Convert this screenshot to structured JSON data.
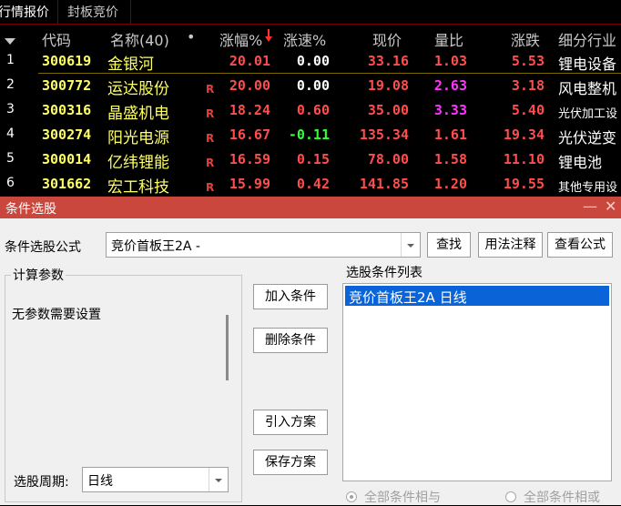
{
  "tabs": [
    "行情报价",
    "封板竞价"
  ],
  "columns": {
    "code": "代码",
    "name": "名称(40)",
    "dot": "•",
    "change_pct": "涨幅%",
    "speed": "涨速%",
    "price": "现价",
    "volume_ratio": "量比",
    "change": "涨跌",
    "industry": "细分行业"
  },
  "rows": [
    {
      "idx": "1",
      "code": "300619",
      "name": "金银河",
      "flag": "",
      "change_pct": "20.01",
      "speed": "0.00",
      "price": "33.16",
      "volume_ratio": "1.03",
      "change": "5.53",
      "industry": "锂电设备"
    },
    {
      "idx": "2",
      "code": "300772",
      "name": "运达股份",
      "flag": "R",
      "change_pct": "20.00",
      "speed": "0.00",
      "price": "19.08",
      "volume_ratio": "2.63",
      "change": "3.18",
      "industry": "风电整机"
    },
    {
      "idx": "3",
      "code": "300316",
      "name": "晶盛机电",
      "flag": "R",
      "change_pct": "18.24",
      "speed": "0.60",
      "price": "35.00",
      "volume_ratio": "3.33",
      "change": "5.40",
      "industry": "光伏加工设"
    },
    {
      "idx": "4",
      "code": "300274",
      "name": "阳光电源",
      "flag": "R",
      "change_pct": "16.67",
      "speed": "-0.11",
      "price": "135.34",
      "volume_ratio": "1.61",
      "change": "19.34",
      "industry": "光伏逆变"
    },
    {
      "idx": "5",
      "code": "300014",
      "name": "亿纬锂能",
      "flag": "R",
      "change_pct": "16.59",
      "speed": "0.15",
      "price": "78.00",
      "volume_ratio": "1.58",
      "change": "11.10",
      "industry": "锂电池"
    },
    {
      "idx": "6",
      "code": "301662",
      "name": "宏工科技",
      "flag": "R",
      "change_pct": "15.99",
      "speed": "0.42",
      "price": "141.85",
      "volume_ratio": "1.20",
      "change": "19.55",
      "industry": "其他专用设"
    }
  ],
  "colors": {
    "up_red": "#ff4d4d",
    "code_yellow": "#ffff66",
    "speed_green": "#33ff33",
    "ratio_magenta": "#ff33ff",
    "title_bar": "#c9473d",
    "selection_blue": "#0a64d8"
  },
  "dialog": {
    "title": "条件选股",
    "minimize": "—",
    "close": "✕",
    "formula_label": "条件选股公式",
    "formula_value": "竞价首板王2A  -",
    "find_button": "查找",
    "usage_button": "用法注释",
    "view_formula_button": "查看公式",
    "params_group_title": "计算参数",
    "params_message": "无参数需要设置",
    "add_button": "加入条件",
    "delete_button": "删除条件",
    "import_button": "引入方案",
    "save_button": "保存方案",
    "list_title": "选股条件列表",
    "list_items": [
      "竞价首板王2A  日线"
    ],
    "period_label": "选股周期:",
    "period_value": "日线",
    "radio_and": "全部条件相与",
    "radio_or": "全部条件相或"
  }
}
